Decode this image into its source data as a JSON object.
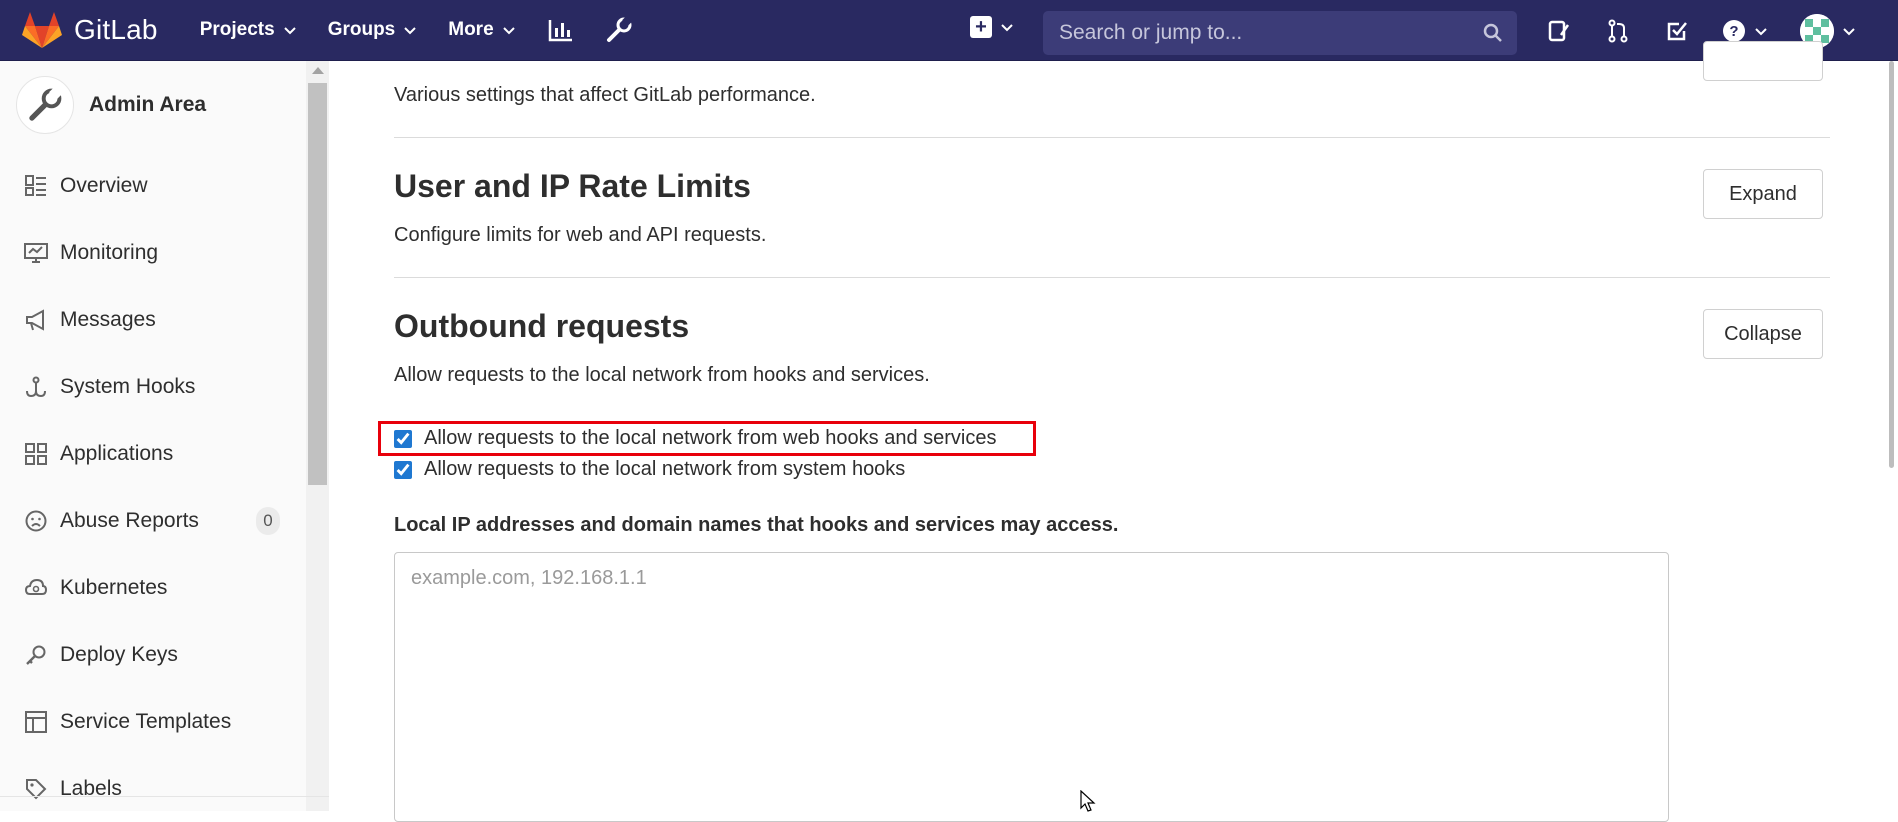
{
  "topbar": {
    "brand": "GitLab",
    "nav": [
      "Projects",
      "Groups",
      "More"
    ],
    "search_placeholder": "Search or jump to..."
  },
  "sidebar": {
    "title": "Admin Area",
    "items": [
      {
        "label": "Overview",
        "icon": "overview-icon"
      },
      {
        "label": "Monitoring",
        "icon": "monitor-icon"
      },
      {
        "label": "Messages",
        "icon": "megaphone-icon"
      },
      {
        "label": "System Hooks",
        "icon": "hook-icon"
      },
      {
        "label": "Applications",
        "icon": "applications-icon"
      },
      {
        "label": "Abuse Reports",
        "icon": "sad-face-icon",
        "badge": "0"
      },
      {
        "label": "Kubernetes",
        "icon": "kubernetes-icon"
      },
      {
        "label": "Deploy Keys",
        "icon": "key-icon"
      },
      {
        "label": "Service Templates",
        "icon": "template-icon"
      },
      {
        "label": "Labels",
        "icon": "label-icon"
      }
    ]
  },
  "main": {
    "performance_desc": "Various settings that affect GitLab performance.",
    "rate_limits": {
      "title": "User and IP Rate Limits",
      "desc": "Configure limits for web and API requests.",
      "button": "Expand"
    },
    "outbound": {
      "title": "Outbound requests",
      "desc": "Allow requests to the local network from hooks and services.",
      "button": "Collapse",
      "checkbox_web_hooks": "Allow requests to the local network from web hooks and services",
      "checkbox_system_hooks": "Allow requests to the local network from system hooks",
      "whitelist_label": "Local IP addresses and domain names that hooks and services may access.",
      "whitelist_placeholder": "example.com, 192.168.1.1"
    }
  },
  "colors": {
    "navbar": "#292961",
    "highlight": "#e8000b"
  }
}
